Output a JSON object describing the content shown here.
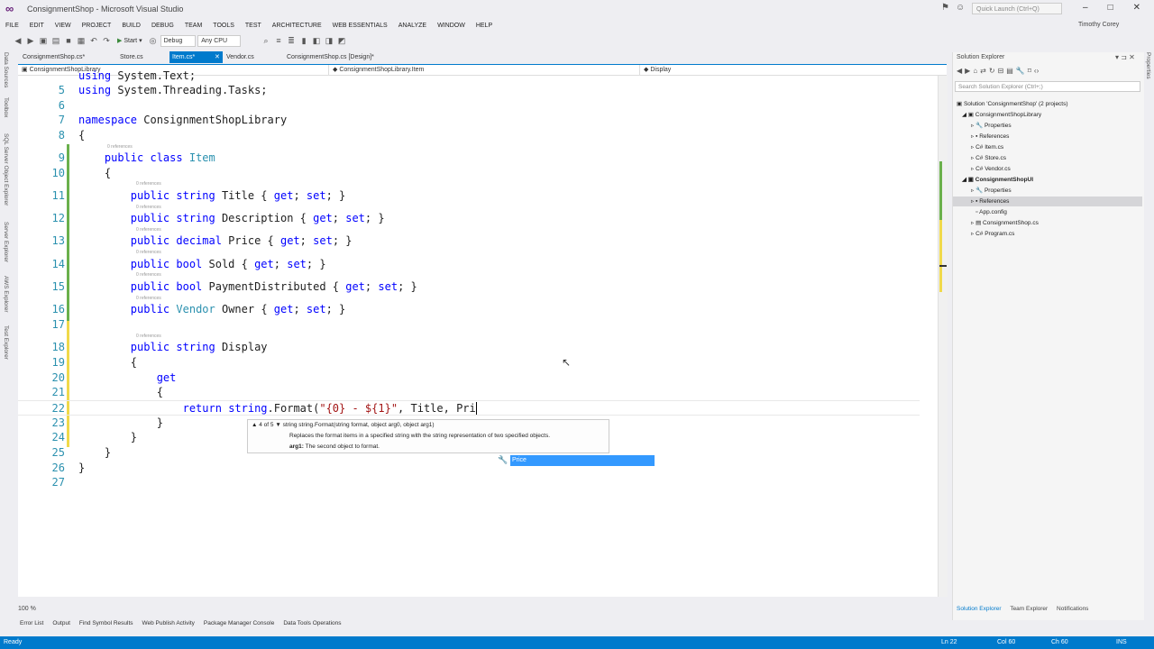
{
  "window": {
    "title": "ConsignmentShop - Microsoft Visual Studio",
    "quick_launch_placeholder": "Quick Launch (Ctrl+Q)",
    "user": "Timothy Corey"
  },
  "menu": [
    "FILE",
    "EDIT",
    "VIEW",
    "PROJECT",
    "BUILD",
    "DEBUG",
    "TEAM",
    "TOOLS",
    "TEST",
    "ARCHITECTURE",
    "WEB ESSENTIALS",
    "ANALYZE",
    "WINDOW",
    "HELP"
  ],
  "toolbar": {
    "start_label": "Start",
    "config": "Debug",
    "platform": "Any CPU"
  },
  "left_rail": [
    "Data Sources",
    "Toolbox",
    "SQL Server Object Explorer",
    "Server Explorer",
    "AWS Explorer",
    "Test Explorer"
  ],
  "tabs": [
    {
      "label": "ConsignmentShop.cs*"
    },
    {
      "label": "Store.cs"
    },
    {
      "label": "Item.cs*"
    },
    {
      "label": "Vendor.cs"
    },
    {
      "label": "ConsignmentShop.cs [Design]*"
    }
  ],
  "navbar": {
    "project": "ConsignmentShopLibrary",
    "class": "ConsignmentShopLibrary.Item",
    "member": "Display"
  },
  "code": [
    {
      "num": "",
      "text": "using System.Text;"
    },
    {
      "num": "5",
      "text": "using System.Threading.Tasks;"
    },
    {
      "num": "6",
      "text": ""
    },
    {
      "num": "7",
      "text": "namespace ConsignmentShopLibrary"
    },
    {
      "num": "8",
      "text": "{"
    },
    {
      "num": "9",
      "text": "    public class Item"
    },
    {
      "num": "10",
      "text": "    {"
    },
    {
      "num": "11",
      "text": "        public string Title { get; set; }"
    },
    {
      "num": "12",
      "text": "        public string Description { get; set; }"
    },
    {
      "num": "13",
      "text": "        public decimal Price { get; set; }"
    },
    {
      "num": "14",
      "text": "        public bool Sold { get; set; }"
    },
    {
      "num": "15",
      "text": "        public bool PaymentDistributed { get; set; }"
    },
    {
      "num": "16",
      "text": "        public Vendor Owner { get; set; }"
    },
    {
      "num": "17",
      "text": ""
    },
    {
      "num": "18",
      "text": "        public string Display"
    },
    {
      "num": "19",
      "text": "        {"
    },
    {
      "num": "20",
      "text": "            get"
    },
    {
      "num": "21",
      "text": "            {"
    },
    {
      "num": "22",
      "text": "                return string.Format(\"{0} - ${1}\", Title, Pri"
    },
    {
      "num": "23",
      "text": "            }"
    },
    {
      "num": "24",
      "text": "        }"
    },
    {
      "num": "25",
      "text": "    }"
    },
    {
      "num": "26",
      "text": "}"
    },
    {
      "num": "27",
      "text": ""
    }
  ],
  "codelens": "0 references",
  "param_tip": {
    "counter": "4 of 5",
    "signature": "string string.Format(string format, object arg0, object arg1)",
    "description": "Replaces the format items in a specified string with the string representation of two specified objects.",
    "param": "arg1:",
    "param_desc": "The second object to format."
  },
  "intellisense_selected": "Price",
  "zoom": "100 %",
  "solution_explorer": {
    "title": "Solution Explorer",
    "search_placeholder": "Search Solution Explorer (Ctrl+;)",
    "items": [
      {
        "label": "Solution 'ConsignmentShop' (2 projects)",
        "indent": 0
      },
      {
        "label": "ConsignmentShopLibrary",
        "indent": 1
      },
      {
        "label": "Properties",
        "indent": 2
      },
      {
        "label": "References",
        "indent": 2
      },
      {
        "label": "Item.cs",
        "indent": 2
      },
      {
        "label": "Store.cs",
        "indent": 2
      },
      {
        "label": "Vendor.cs",
        "indent": 2
      },
      {
        "label": "ConsignmentShopUI",
        "indent": 1
      },
      {
        "label": "Properties",
        "indent": 2
      },
      {
        "label": "References",
        "indent": 2
      },
      {
        "label": "App.config",
        "indent": 2
      },
      {
        "label": "ConsignmentShop.cs",
        "indent": 2
      },
      {
        "label": "Program.cs",
        "indent": 2
      }
    ],
    "tabs": [
      "Solution Explorer",
      "Team Explorer",
      "Notifications"
    ]
  },
  "right_rail": [
    "Properties"
  ],
  "bottom_tabs": [
    "Error List",
    "Output",
    "Find Symbol Results",
    "Web Publish Activity",
    "Package Manager Console",
    "Data Tools Operations"
  ],
  "status": {
    "ready": "Ready",
    "ln": "Ln 22",
    "col": "Col 60",
    "ch": "Ch 60",
    "ins": "INS"
  },
  "colors": {
    "accent": "#007acc",
    "keyword": "#0000ff",
    "type": "#2b91af",
    "string": "#a31515",
    "line_number": "#2b91af"
  }
}
